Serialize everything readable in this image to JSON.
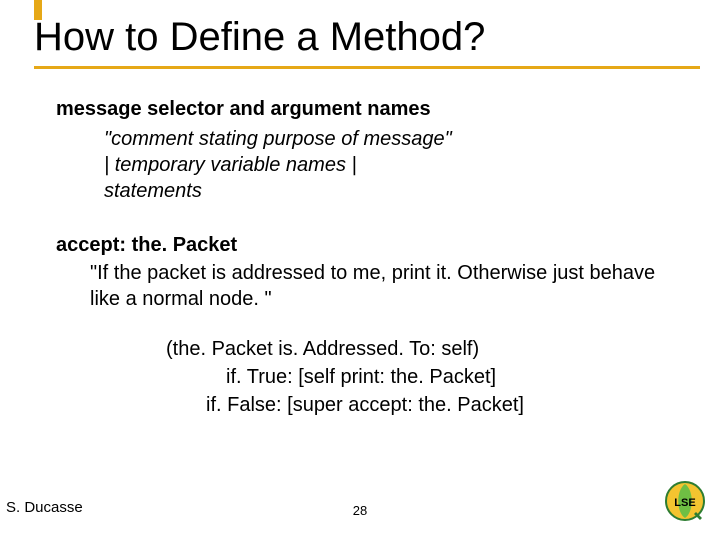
{
  "title": "How to Define a Method?",
  "template": {
    "selector": "message selector and argument names",
    "comment": "\"comment stating purpose of message\"",
    "temps": "| temporary variable names |",
    "stmts": "statements"
  },
  "example": {
    "selector": "accept: the. Packet",
    "comment": "\"If the packet is addressed to me, print it. Otherwise just behave like a normal node. \"",
    "expr": "(the. Packet is. Addressed. To: self)",
    "ifTrue": "if. True: [self print: the. Packet]",
    "ifFalse": "if. False: [super accept: the. Packet]"
  },
  "footer": {
    "author": "S. Ducasse",
    "page": "28",
    "logo_label": "LSE"
  }
}
